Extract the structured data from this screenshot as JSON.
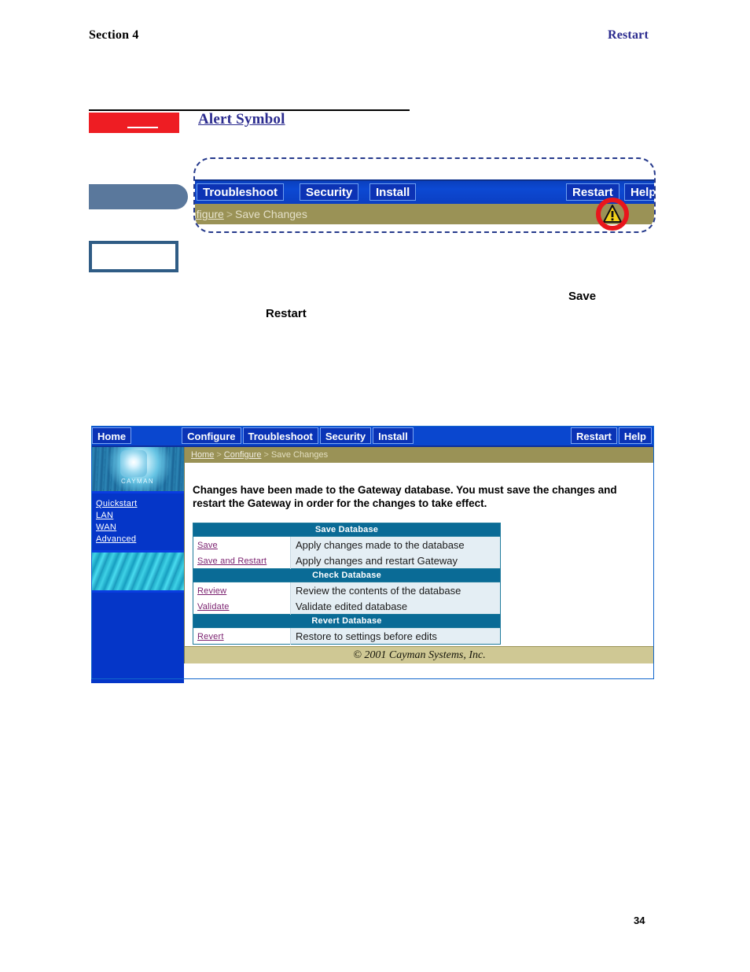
{
  "page": {
    "section_label": "Section 4",
    "header_chapter": "Restart",
    "page_number": "34"
  },
  "heading": {
    "title": "Alert Symbol"
  },
  "callout_detail": {
    "nav_buttons": [
      "Troubleshoot",
      "Security",
      "Install"
    ],
    "nav_right_buttons": [
      "Restart",
      "Help"
    ],
    "breadcrumb": {
      "truncated_link": "nfigure",
      "separator": ">",
      "current": "Save Changes"
    },
    "alert_icon_name": "warning-triangle-icon",
    "highlight_color": "#e8161c"
  },
  "body_words": {
    "save": "Save",
    "restart": "Restart"
  },
  "screenshot": {
    "nav": {
      "home": "Home",
      "items": [
        "Configure",
        "Troubleshoot",
        "Security",
        "Install"
      ],
      "right": [
        "Restart",
        "Help"
      ]
    },
    "sidebar": {
      "logo_text": "CAYMAN",
      "links": [
        "Quickstart",
        "LAN",
        "WAN",
        "Advanced"
      ]
    },
    "breadcrumb": {
      "links": [
        "Home",
        "Configure"
      ],
      "separator": ">",
      "current": "Save Changes"
    },
    "message": "Changes have been made to the Gateway database. You must save the changes and restart the Gateway in order for the changes to take effect.",
    "table": {
      "sections": [
        {
          "header": "Save Database",
          "rows": [
            {
              "link": "Save",
              "description": "Apply changes made to the database"
            },
            {
              "link": "Save and Restart",
              "description": "Apply changes and restart Gateway"
            }
          ]
        },
        {
          "header": "Check Database",
          "rows": [
            {
              "link": "Review",
              "description": "Review the contents of the database"
            },
            {
              "link": "Validate",
              "description": "Validate edited database"
            }
          ]
        },
        {
          "header": "Revert Database",
          "rows": [
            {
              "link": "Revert",
              "description": "Restore to settings before edits"
            }
          ]
        }
      ]
    },
    "footer": "© 2001 Cayman Systems, Inc."
  },
  "colors": {
    "heading_blue": "#2b2b8f",
    "alert_red": "#ee1d23",
    "nav_blue": "#0a47cf",
    "breadcrumb_khaki": "#9a9256",
    "table_header": "#0a6b96",
    "link_purple": "#7a1f6e"
  }
}
